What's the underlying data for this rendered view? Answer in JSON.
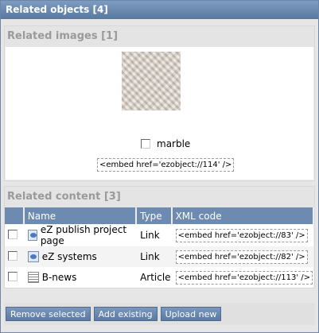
{
  "panel": {
    "title": "Related objects [4]"
  },
  "images_section": {
    "title": "Related images [1]",
    "image": {
      "name": "marble",
      "embed": "<embed href='ezobject://114' />"
    }
  },
  "content_section": {
    "title": "Related content [3]",
    "columns": {
      "name": "Name",
      "type": "Type",
      "xml": "XML code"
    },
    "rows": [
      {
        "name": "eZ publish project page",
        "type": "Link",
        "xml": "<embed href='ezobject://83' />",
        "icon": "link-icon"
      },
      {
        "name": "eZ systems",
        "type": "Link",
        "xml": "<embed href='ezobject://82' />",
        "icon": "link-icon"
      },
      {
        "name": "B-news",
        "type": "Article",
        "xml": "<embed href='ezobject://113' />",
        "icon": "article-icon"
      }
    ]
  },
  "buttons": {
    "remove_selected": "Remove selected",
    "add_existing": "Add existing",
    "upload_new": "Upload new"
  },
  "colors": {
    "header_bar": "#5778a0",
    "table_header": "#6d8bb1",
    "section_title": "#9a9a9a"
  }
}
